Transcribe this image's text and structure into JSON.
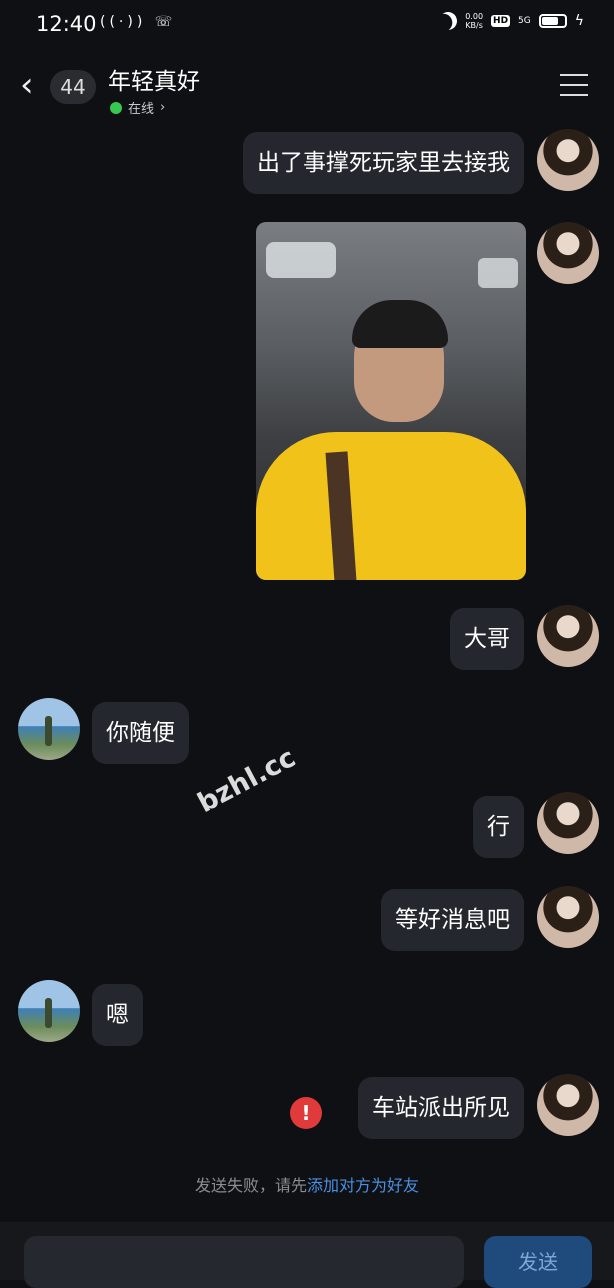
{
  "status_bar": {
    "time": "12:40",
    "left_icons": "((·)) ☏",
    "net_speed_value": "0.00",
    "net_speed_unit": "KB/s",
    "hd": "HD",
    "signal": "5G",
    "battery_percent": 0.75
  },
  "header": {
    "back_icon": "‹",
    "unread_count": "44",
    "title": "年轻真好",
    "status": "在线",
    "status_chevron": "›"
  },
  "messages": [
    {
      "side": "right",
      "text": "出了事撑死玩家里去接我"
    },
    {
      "side": "right",
      "type": "image"
    },
    {
      "side": "right",
      "text": "大哥"
    },
    {
      "side": "left",
      "text": "你随便"
    },
    {
      "side": "right",
      "text": "行"
    },
    {
      "side": "right",
      "text": "等好消息吧"
    },
    {
      "side": "left",
      "text": "嗯"
    },
    {
      "side": "right",
      "text": "车站派出所见",
      "failed": true
    }
  ],
  "fail_icon": "!",
  "watermark": "bzhl.cc",
  "notice": {
    "prefix": "发送失败，请先",
    "link": "添加对方为好友"
  },
  "composer": {
    "placeholder": "",
    "send_label": "发送"
  }
}
